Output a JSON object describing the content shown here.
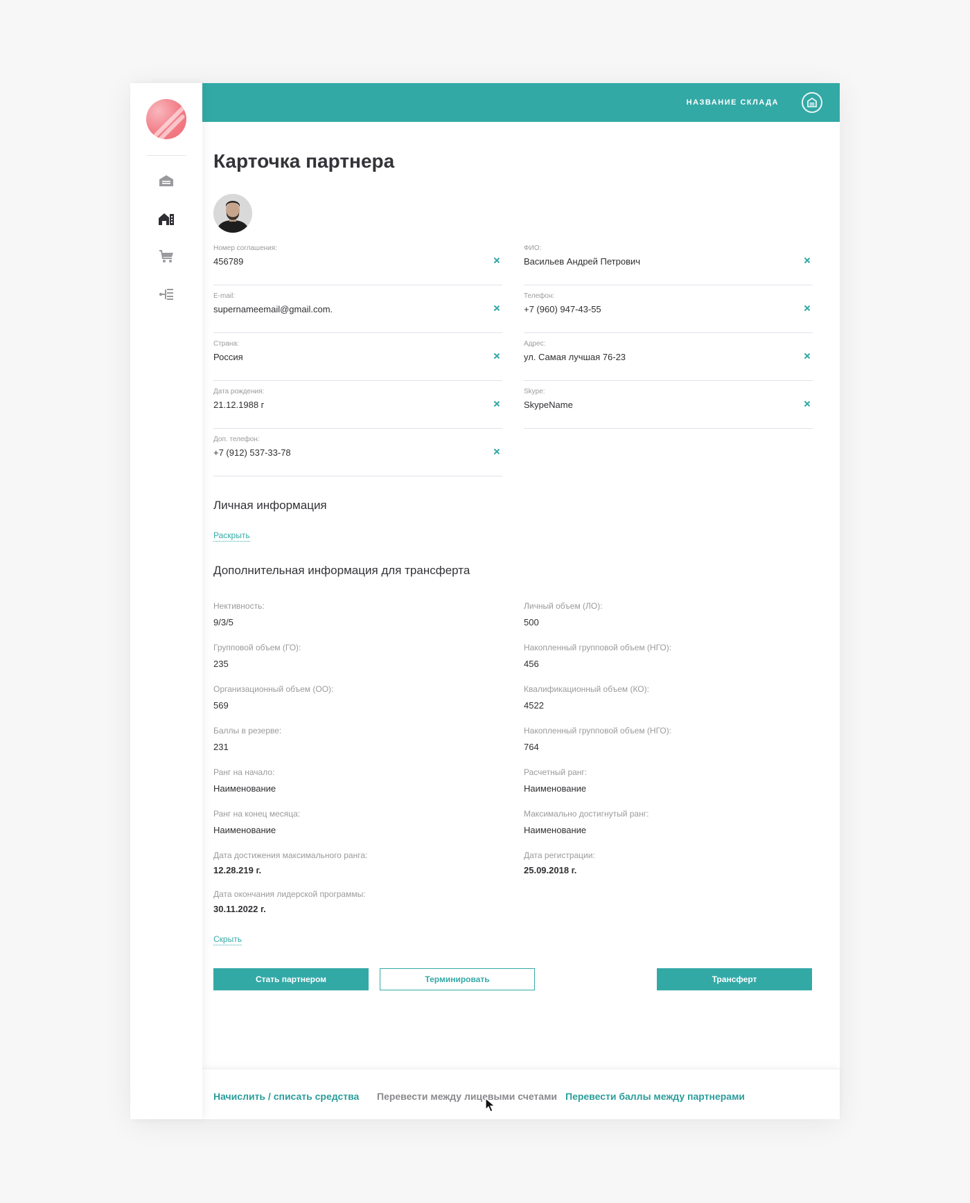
{
  "header": {
    "warehouse_name": "НАЗВАНИЕ СКЛАДА",
    "icon": "warehouse-icon",
    "color": "#33a9a6"
  },
  "sidebar": {
    "items": [
      {
        "icon": "warehouse-icon"
      },
      {
        "icon": "store-icon"
      },
      {
        "icon": "cart-icon"
      },
      {
        "icon": "tree-icon"
      }
    ]
  },
  "page": {
    "title": "Карточка партнера"
  },
  "fields": {
    "agreement": {
      "label": "Номер соглашения:",
      "value": "456789"
    },
    "fio": {
      "label": "ФИО:",
      "value": "Васильев Андрей Петрович"
    },
    "email": {
      "label": "E-mail:",
      "value": "supernameemail@gmail.com."
    },
    "phone": {
      "label": "Телефон:",
      "value": "+7 (960) 947-43-55"
    },
    "country": {
      "label": "Страна:",
      "value": "Россия"
    },
    "address": {
      "label": "Адрес:",
      "value": "ул. Самая лучшая 76-23"
    },
    "birthdate": {
      "label": "Дата рождения:",
      "value": "21.12.1988 г"
    },
    "skype": {
      "label": "Skype:",
      "value": "SkypeName"
    },
    "extra_phone": {
      "label": "Доп. телефон:",
      "value": "+7 (912) 537-33-78"
    }
  },
  "personal": {
    "title": "Личная информация",
    "expand": "Раскрыть"
  },
  "transfer": {
    "title": "Дополнительная информация для трансферта",
    "left": [
      {
        "label": "Нективность:",
        "value": "9/3/5"
      },
      {
        "label": "Групповой объем (ГО):",
        "value": "235"
      },
      {
        "label": "Организационный объем (ОО):",
        "value": "569"
      },
      {
        "label": "Баллы в резерве:",
        "value": "231"
      },
      {
        "label": "Ранг на начало:",
        "value": "Наименование"
      },
      {
        "label": "Ранг на конец месяца:",
        "value": "Наименование"
      },
      {
        "label": "Дата достижения максимального ранга:",
        "value": "12.28.219 г."
      },
      {
        "label": "Дата окончания лидерской программы:",
        "value": "30.11.2022 г."
      }
    ],
    "right": [
      {
        "label": "Личный объем (ЛО):",
        "value": "500"
      },
      {
        "label": "Накопленный групповой объем (НГО):",
        "value": "456"
      },
      {
        "label": "Квалификационный объем (КО):",
        "value": "4522"
      },
      {
        "label": "Накопленный групповой объем (НГО):",
        "value": "764"
      },
      {
        "label": "Расчетный ранг:",
        "value": "Наименование"
      },
      {
        "label": "Максимально достигнутый ранг:",
        "value": "Наименование"
      },
      {
        "label": "Дата регистрации:",
        "value": "25.09.2018 г."
      }
    ],
    "collapse": "Скрыть"
  },
  "actions": {
    "become_partner": "Стать партнером",
    "terminate": "Терминировать",
    "transfer": "Трансферт"
  },
  "footer": {
    "accrue": "Начислить / списать средства",
    "between_accounts": "Перевести между лицевыми счетами",
    "points_between_partners": "Перевести баллы между партнерами"
  }
}
